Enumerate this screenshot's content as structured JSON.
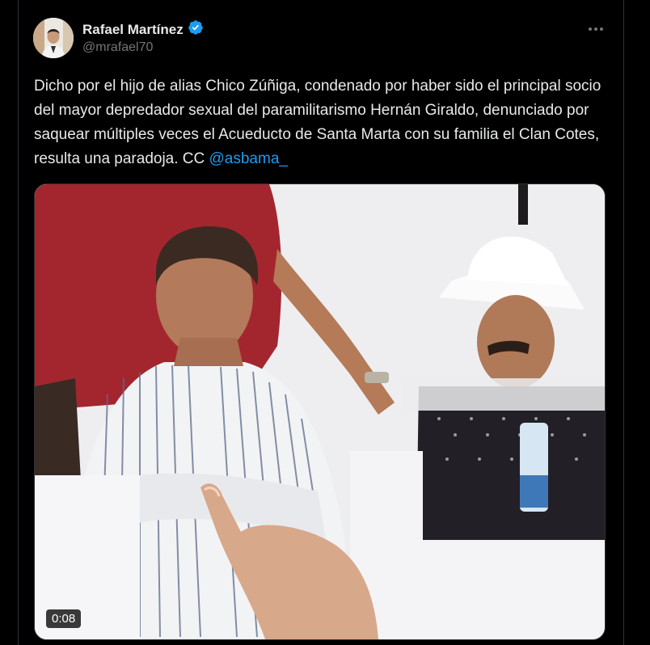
{
  "author": {
    "name": "Rafael Martínez",
    "handle": "@mrafael70",
    "verified": true,
    "verified_color": "#1d9bf0"
  },
  "tweet": {
    "text": "Dicho por el hijo de alias Chico Zúñiga, condenado por haber sido el principal socio del mayor depredador sexual del paramilitarismo Hernán Giraldo, denunciado por saquear múltiples veces el Acueducto de Santa Marta con su familia el Clan Cotes, resulta una paradoja. CC ",
    "mention": "@asbama_"
  },
  "media": {
    "type": "video",
    "duration": "0:08"
  },
  "icons": {
    "more": "more-horizontal-icon",
    "verified": "verified-badge-icon"
  },
  "colors": {
    "background": "#000000",
    "text": "#e7e9ea",
    "secondary_text": "#71767b",
    "link": "#1d9bf0",
    "border": "#2f3336"
  }
}
